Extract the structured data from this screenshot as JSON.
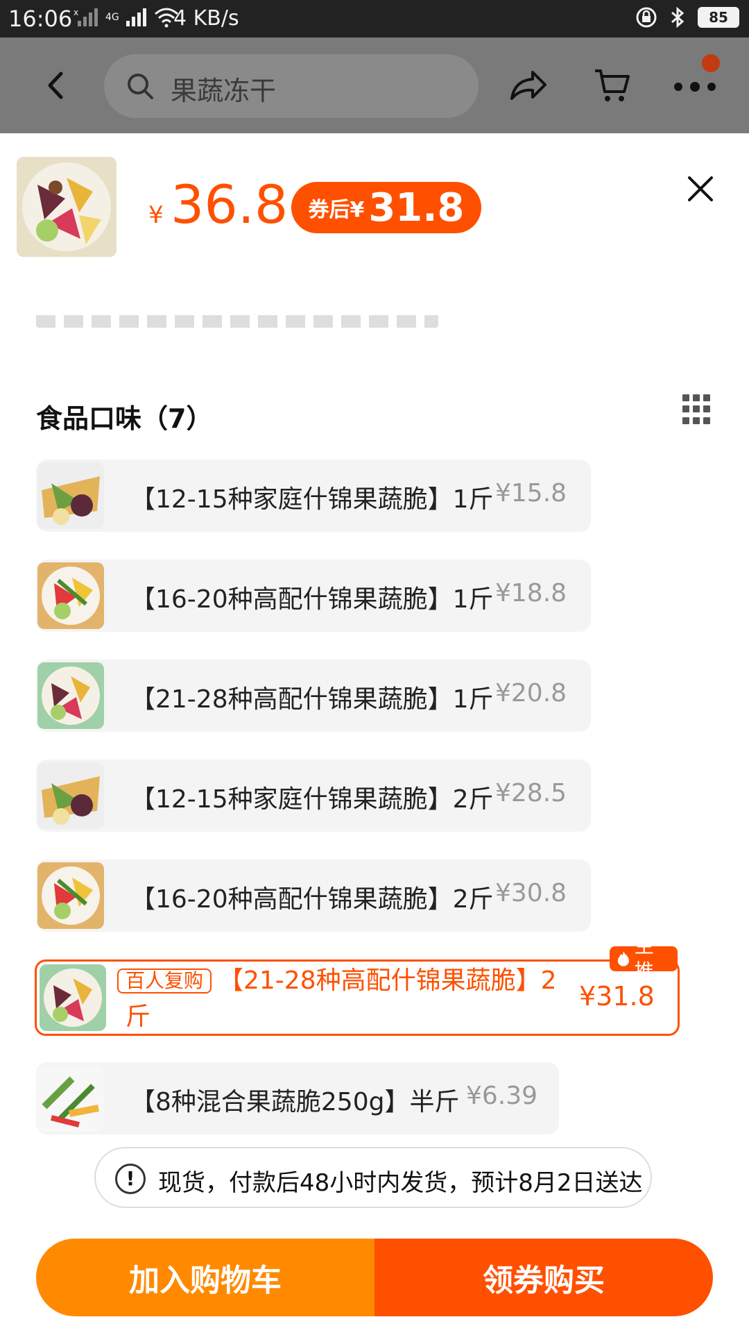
{
  "status_bar": {
    "time": "16:06",
    "network": "4G",
    "speed": "4 KB/s",
    "battery": "85"
  },
  "header": {
    "search_text": "果蔬冻干"
  },
  "product": {
    "price_symbol": "¥",
    "price": "36.8",
    "coupon_label": "券后¥",
    "coupon_price": "31.8"
  },
  "section": {
    "title": "食品口味（7）"
  },
  "options": [
    {
      "label": "【12-15种家庭什锦果蔬脆】1斤",
      "price": "¥15.8"
    },
    {
      "label": "【16-20种高配什锦果蔬脆】1斤",
      "price": "¥18.8"
    },
    {
      "label": "【21-28种高配什锦果蔬脆】1斤",
      "price": "¥20.8"
    },
    {
      "label": "【12-15种家庭什锦果蔬脆】2斤",
      "price": "¥28.5"
    },
    {
      "label": "【16-20种高配什锦果蔬脆】2斤",
      "price": "¥30.8"
    }
  ],
  "selected_option": {
    "badge": "百人复购",
    "label_line1": "【21-28种高配什锦果蔬脆】2",
    "label_line2": "斤",
    "price": "¥31.8",
    "tag": "主推"
  },
  "last_option": {
    "label": "【8种混合果蔬脆250g】半斤",
    "price": "¥6.39"
  },
  "notice": {
    "text": "现货，付款后48小时内发货，预计8月2日送达"
  },
  "buttons": {
    "add_to_cart": "加入购物车",
    "buy": "领券购买"
  },
  "colors": {
    "accent": "#ff5000",
    "accent_light": "#ff8a00"
  }
}
